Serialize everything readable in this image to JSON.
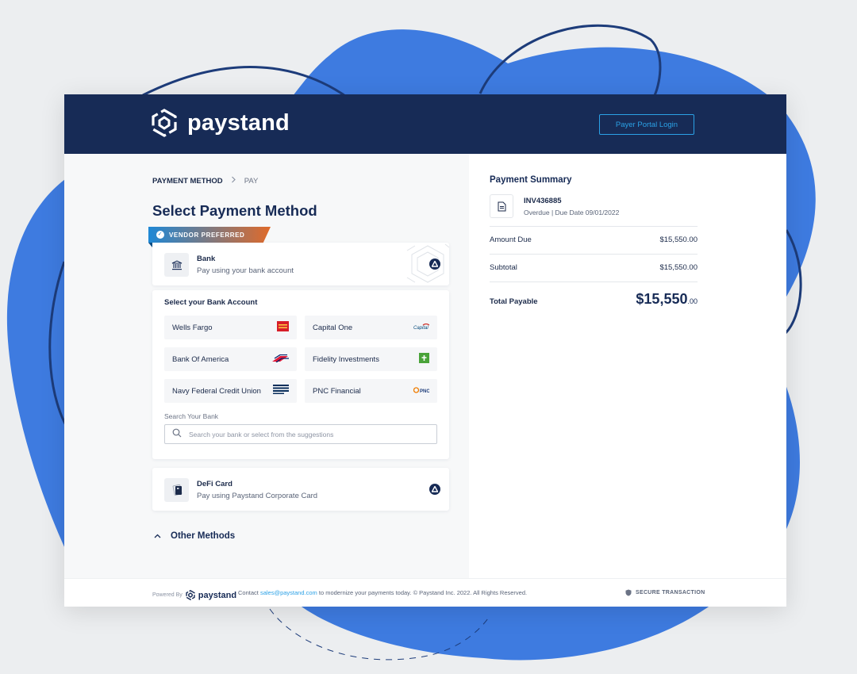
{
  "brand": {
    "name": "paystand",
    "accent": "#2ba1e6",
    "navy": "#172b56",
    "blob": "#3e7be0"
  },
  "header": {
    "portal_button": "Payer Portal Login"
  },
  "breadcrumb": {
    "step1": "PAYMENT METHOD",
    "step2": "PAY"
  },
  "main": {
    "title": "Select Payment Method",
    "ribbon": "VENDOR PREFERRED",
    "bank_method": {
      "title": "Bank",
      "subtitle": "Pay using your bank account",
      "icon": "bank-icon"
    },
    "bank_select": {
      "heading": "Select your Bank Account",
      "banks": [
        {
          "name": "Wells Fargo",
          "logo": "wells-fargo-logo"
        },
        {
          "name": "Capital One",
          "logo": "capital-one-logo"
        },
        {
          "name": "Bank Of America",
          "logo": "bank-of-america-logo"
        },
        {
          "name": "Fidelity Investments",
          "logo": "fidelity-logo"
        },
        {
          "name": "Navy Federal Credit Union",
          "logo": "navy-federal-logo"
        },
        {
          "name": "PNC Financial",
          "logo": "pnc-logo"
        }
      ],
      "search_label": "Search Your Bank",
      "search_placeholder": "Search your bank or select from the suggestions"
    },
    "defi_method": {
      "title": "DeFi Card",
      "subtitle": "Pay using Paystand Corporate Card"
    },
    "other_methods": "Other Methods"
  },
  "summary": {
    "title": "Payment Summary",
    "invoice_id": "INV436885",
    "invoice_status": "Overdue | Due Date 09/01/2022",
    "amount_due_label": "Amount Due",
    "amount_due_value": "$15,550.00",
    "subtotal_label": "Subtotal",
    "subtotal_value": "$15,550.00",
    "total_label": "Total Payable",
    "total_main": "$15,550",
    "total_cents": ".00"
  },
  "footer": {
    "powered_by": "Powered By",
    "logo_text": "paystand",
    "contact_prefix": "Contact",
    "contact_email": "sales@paystand.com",
    "contact_suffix": "to modernize your payments today.",
    "copyright": "© Paystand Inc. 2022. All Rights Reserved.",
    "secure": "SECURE TRANSACTION"
  }
}
